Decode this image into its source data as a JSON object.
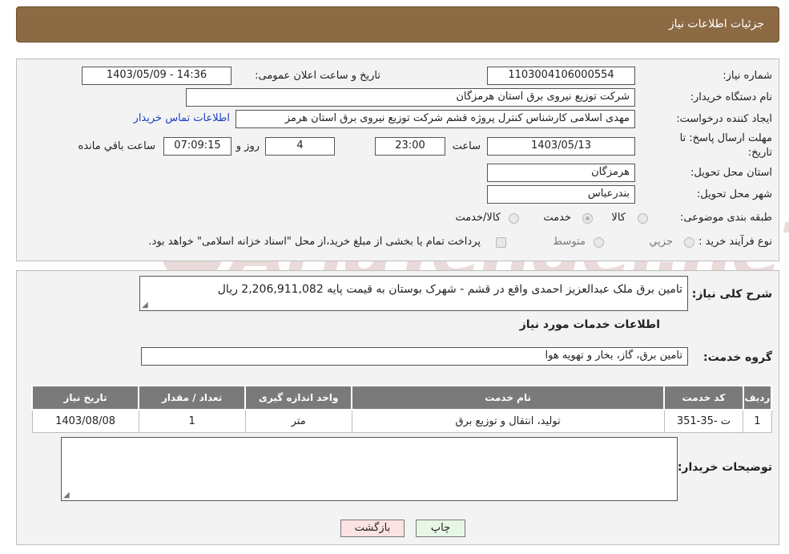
{
  "header": {
    "title": "جزئیات اطلاعات نیاز"
  },
  "form": {
    "need_number_label": "شماره نیاز:",
    "need_number": "1103004106000554",
    "announce_label": "تاریخ و ساعت اعلان عمومی:",
    "announce_value": "1403/05/09 - 14:36",
    "buyer_org_label": "نام دستگاه خریدار:",
    "buyer_org": "شرکت توزیع نیروی برق استان هرمزگان",
    "creator_label": "ایجاد کننده درخواست:",
    "creator": "مهدی اسلامی کارشناس کنترل پروژه قشم شرکت توزیع نیروی برق استان هرمز",
    "contact_link": "اطلاعات تماس خریدار",
    "deadline_label_1": "مهلت ارسال پاسخ: تا",
    "deadline_label_2": "تاریخ:",
    "deadline_date": "1403/05/13",
    "time_label": "ساعت",
    "deadline_time": "23:00",
    "days_value": "4",
    "days_label": "روز و",
    "remaining_time": "07:09:15",
    "remaining_label": "ساعت باقي مانده",
    "province_label": "استان محل تحویل:",
    "province": "هرمزگان",
    "city_label": "شهر محل تحویل:",
    "city": "بندرعباس",
    "category_label": "طبقه بندی موضوعی:",
    "category_options": [
      "کالا",
      "خدمت",
      "کالا/خدمت"
    ],
    "category_selected": "خدمت",
    "purchase_type_label": "نوع فرآیند خرید :",
    "purchase_options": [
      "جزیي",
      "متوسط"
    ],
    "payment_note": "پرداخت تمام یا بخشی از مبلغ خرید،از محل \"اسناد خزانه اسلامی\" خواهد بود."
  },
  "watermark": {
    "text": "AriaTender.neT"
  },
  "details": {
    "summary_label": "شرح کلی نیاز:",
    "summary": "تامین برق ملک عبدالعزیز احمدی واقع در قشم - شهرک بوستان به قیمت پایه  2,206,911,082 ریال",
    "services_heading": "اطلاعات خدمات مورد نیاز",
    "service_group_label": "گروه خدمت:",
    "service_group": "تامین برق، گاز، بخار و تهویه هوا",
    "table": {
      "headers": [
        "ردیف",
        "کد خدمت",
        "نام خدمت",
        "واحد اندازه گیری",
        "تعداد / مقدار",
        "تاریخ نیاز"
      ],
      "rows": [
        [
          "1",
          "ت -35-351",
          "تولید، انتقال و توزیع برق",
          "متر",
          "1",
          "1403/08/08"
        ]
      ]
    },
    "buyer_notes_label": "توضیحات خریدار:",
    "buyer_notes": ""
  },
  "buttons": {
    "print": "چاپ",
    "back": "بازگشت"
  },
  "colors": {
    "header": "#8b6a44",
    "table_header": "#7a7a7a",
    "link": "#1a3fc4",
    "back_button": "#fde2e2",
    "print_button": "#e6f7e6"
  }
}
